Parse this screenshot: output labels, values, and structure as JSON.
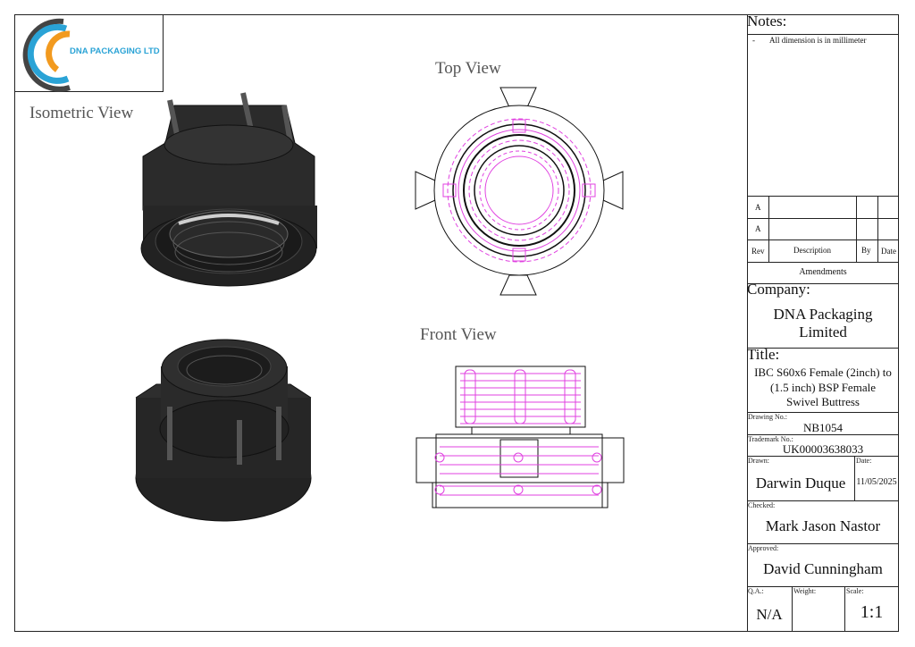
{
  "logo": {
    "text": "DNA PACKAGING LTD",
    "colors": {
      "blue": "#2aa3d6",
      "orange": "#f29a1f",
      "dark": "#444444"
    }
  },
  "views": {
    "isometric": "Isometric View",
    "top": "Top View",
    "front": "Front View"
  },
  "notes": {
    "heading": "Notes:",
    "items": [
      {
        "bullet": "-",
        "text": "All dimension is in millimeter"
      }
    ]
  },
  "amendments": {
    "rows": [
      {
        "rev": "A"
      },
      {
        "rev": "A"
      }
    ],
    "headers": {
      "rev": "Rev",
      "description": "Description",
      "by": "By",
      "date": "Date"
    },
    "title": "Amendments"
  },
  "company": {
    "label": "Company:",
    "line1": "DNA Packaging",
    "line2": "Limited"
  },
  "title_block": {
    "label": "Title:",
    "line1": "IBC S60x6 Female (2inch) to",
    "line2": "(1.5 inch) BSP Female",
    "line3": "Swivel Buttress"
  },
  "drawing_no": {
    "label": "Drawing No.:",
    "value": "NB1054"
  },
  "trademark_no": {
    "label": "Trademark No.:",
    "value": "UK00003638033"
  },
  "drawn": {
    "label": "Drawn:",
    "value": "Darwin Duque"
  },
  "date": {
    "label": "Date:",
    "value": "11/05/2025"
  },
  "checked": {
    "label": "Checked:",
    "value": "Mark Jason Nastor"
  },
  "approved": {
    "label": "Approved:",
    "value": "David Cunningham"
  },
  "qa": {
    "label": "Q.A.:",
    "value": "N/A"
  },
  "weight": {
    "label": "Weight:",
    "value": ""
  },
  "scale": {
    "label": "Scale:",
    "value": "1:1"
  },
  "colors": {
    "hidden_line": "#e040e0",
    "body": "#2a2a2a",
    "line": "#111111"
  }
}
